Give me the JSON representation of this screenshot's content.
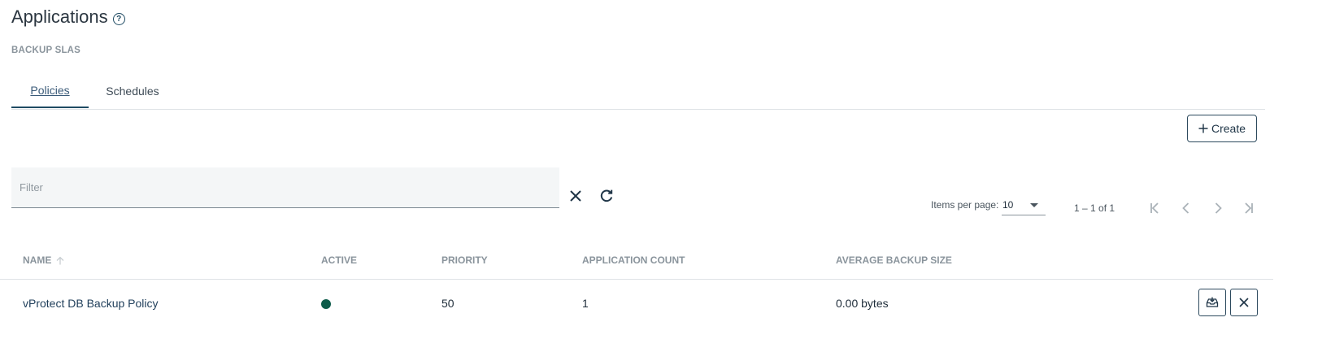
{
  "header": {
    "title": "Applications",
    "help_icon": "help-circle-icon"
  },
  "section": {
    "subtitle": "BACKUP SLAS"
  },
  "tabs": [
    {
      "label": "Policies",
      "active": true
    },
    {
      "label": "Schedules",
      "active": false
    }
  ],
  "toolbar": {
    "create_label": "Create",
    "create_icon": "plus-icon"
  },
  "filter": {
    "placeholder": "Filter",
    "value": "",
    "clear_icon": "close-icon",
    "refresh_icon": "refresh-icon"
  },
  "paginator": {
    "items_per_page_label": "Items per page:",
    "items_per_page": "10",
    "range": "1 – 1 of 1",
    "icons": [
      "first-page-icon",
      "previous-page-icon",
      "next-page-icon",
      "last-page-icon"
    ]
  },
  "table": {
    "columns": [
      "NAME",
      "ACTIVE",
      "PRIORITY",
      "APPLICATION COUNT",
      "AVERAGE BACKUP SIZE"
    ],
    "sort": {
      "column": "NAME",
      "direction": "ascending"
    },
    "rows": [
      {
        "name": "vProtect DB Backup Policy",
        "active": true,
        "priority": "50",
        "application_count": "1",
        "average_backup_size": "0.00 bytes"
      }
    ]
  },
  "colors": {
    "primary": "#1f4b63",
    "active_status": "#0d5c4a",
    "muted": "#8a949c"
  }
}
